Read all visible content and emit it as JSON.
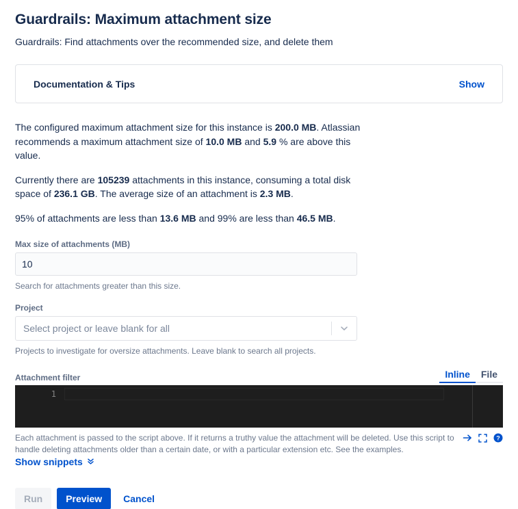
{
  "header": {
    "title": "Guardrails: Maximum attachment size",
    "subtitle": "Guardrails: Find attachments over the recommended size, and delete them"
  },
  "doc_panel": {
    "title": "Documentation & Tips",
    "show_label": "Show"
  },
  "info": {
    "paragraph1": {
      "part1": "The configured maximum attachment size for this instance is ",
      "configured_max": "200.0 MB",
      "part2": ". Atlassian recommends a maximum attachment size of ",
      "recommended_max": "10.0 MB",
      "part3": " and ",
      "percent_above": "5.9",
      "part4": " % are above this value."
    },
    "paragraph2": {
      "part1": "Currently there are ",
      "attachment_count": "105239",
      "part2": " attachments in this instance, consuming a total disk space of ",
      "total_disk_space": "236.1 GB",
      "part3": ". The average size of an attachment is ",
      "average_size": "2.3 MB",
      "part4": "."
    },
    "paragraph3": {
      "part1": "95% of attachments are less than ",
      "p95": "13.6 MB",
      "part2": " and 99% are less than ",
      "p99": "46.5 MB",
      "part3": "."
    }
  },
  "form": {
    "max_size": {
      "label": "Max size of attachments (MB)",
      "value": "10",
      "placeholder": "",
      "help": "Search for attachments greater than this size."
    },
    "project": {
      "label": "Project",
      "selected": "Select project or leave blank for all",
      "help": "Projects to investigate for oversize attachments. Leave blank to search all projects."
    },
    "attachment_filter": {
      "label": "Attachment filter",
      "tabs": [
        {
          "label": "Inline",
          "active": true
        },
        {
          "label": "File",
          "active": false
        }
      ],
      "line_number": "1",
      "code": "",
      "description": "Each attachment is passed to the script above. If it returns a truthy value the attachment will be deleted. Use this script to handle deleting attachments older than a certain date, or with a particular extension etc. See the examples.",
      "snippets_label": "Show snippets",
      "icons": [
        "arrow-right-icon",
        "expand-icon",
        "help-icon"
      ]
    }
  },
  "actions": {
    "run_label": "Run",
    "preview_label": "Preview",
    "cancel_label": "Cancel"
  },
  "colors": {
    "accent": "#0052CC",
    "text": "#172B4D",
    "muted": "#6B778C",
    "label": "#5E6C84",
    "border": "#DFE1E6",
    "editor_bg": "#1E1E1E"
  }
}
